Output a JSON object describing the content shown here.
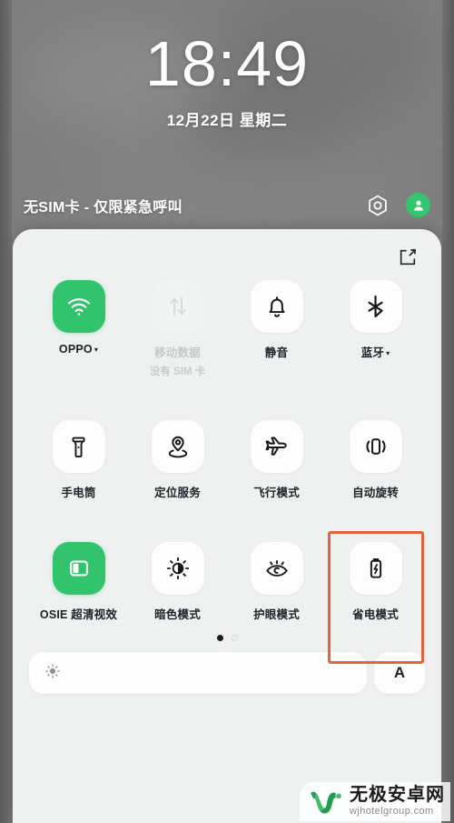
{
  "lockscreen": {
    "time": "18:49",
    "date": "12月22日  星期二",
    "carrier": "无SIM卡 - 仅限紧急呼叫",
    "scan_icon": "scan-hexagon-icon",
    "avatar_icon": "user-avatar-icon"
  },
  "quick_settings": {
    "edit_label": "edit-icon",
    "tiles": [
      {
        "label": "OPPO",
        "caret": "▾",
        "sub": "",
        "state": "on",
        "icon": "wifi-icon"
      },
      {
        "label": "移动数据",
        "caret": "",
        "sub": "没有 SIM 卡",
        "state": "disabled",
        "icon": "mobile-data-icon"
      },
      {
        "label": "静音",
        "caret": "",
        "sub": "",
        "state": "off",
        "icon": "bell-silent-icon"
      },
      {
        "label": "蓝牙",
        "caret": "▾",
        "sub": "",
        "state": "off",
        "icon": "bluetooth-icon"
      },
      {
        "label": "手电筒",
        "caret": "",
        "sub": "",
        "state": "off",
        "icon": "flashlight-icon"
      },
      {
        "label": "定位服务",
        "caret": "",
        "sub": "",
        "state": "off",
        "icon": "location-pin-icon"
      },
      {
        "label": "飞行模式",
        "caret": "",
        "sub": "",
        "state": "off",
        "icon": "airplane-icon"
      },
      {
        "label": "自动旋转",
        "caret": "",
        "sub": "",
        "state": "off",
        "icon": "auto-rotate-icon"
      },
      {
        "label": "OSIE 超清视效",
        "caret": "",
        "sub": "",
        "state": "on",
        "icon": "osie-screen-icon"
      },
      {
        "label": "暗色模式",
        "caret": "",
        "sub": "",
        "state": "off",
        "icon": "dark-mode-icon"
      },
      {
        "label": "护眼模式",
        "caret": "",
        "sub": "",
        "state": "off",
        "icon": "eye-care-icon"
      },
      {
        "label": "省电模式",
        "caret": "",
        "sub": "",
        "state": "off",
        "icon": "battery-saver-icon",
        "highlighted": true
      }
    ],
    "pages": {
      "count": 2,
      "active_index": 0
    },
    "brightness": {
      "icon": "brightness-sun-icon",
      "value_percent": 3,
      "auto_label": "A"
    }
  },
  "colors": {
    "accent_green": "#32c46d",
    "highlight_border": "#e2643c",
    "panel_bg": "#eef1f0",
    "tile_bg": "#fdfdfd",
    "wallpaper": "#7e7e7e"
  },
  "watermark": {
    "name": "无极安卓网",
    "url": "wjhotelgroup.com",
    "logo": "w-logo-icon"
  }
}
